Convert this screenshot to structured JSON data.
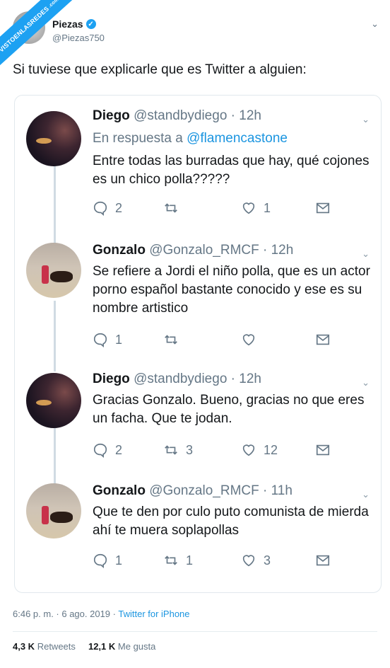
{
  "watermark": {
    "main": "VISTOENLASREDES",
    "suffix": ".com"
  },
  "header": {
    "author": "Piezas",
    "handle": "@Piezas750",
    "text": "Si tuviese que explicarle que es Twitter a alguien:"
  },
  "replies": [
    {
      "name": "Diego",
      "handle": "@standbydiego · 12h",
      "in_reply_prefix": "En respuesta a ",
      "in_reply_user": "@flamencastone",
      "text": "Entre todas las burradas que hay, qué cojones es un chico polla?????",
      "replies": "2",
      "retweets": "",
      "likes": "1"
    },
    {
      "name": "Gonzalo",
      "handle": "@Gonzalo_RMCF · 12h",
      "text": "Se refiere a Jordi el niño polla, que es un actor porno español bastante conocido y ese es su nombre artistico",
      "replies": "1",
      "retweets": "",
      "likes": ""
    },
    {
      "name": "Diego",
      "handle": "@standbydiego · 12h",
      "text": "Gracias Gonzalo. Bueno, gracias no que eres un facha. Que te jodan.",
      "replies": "2",
      "retweets": "3",
      "likes": "12"
    },
    {
      "name": "Gonzalo",
      "handle": "@Gonzalo_RMCF · 11h",
      "text": "Que te den por culo puto comunista de mierda ahí te muera soplapollas",
      "replies": "1",
      "retweets": "1",
      "likes": "3"
    }
  ],
  "meta": {
    "time": "6:46 p. m. · 6 ago. 2019 · ",
    "source": "Twitter for iPhone"
  },
  "stats": {
    "retweets_count": "4,3 K",
    "retweets_label": "Retweets",
    "likes_count": "12,1 K",
    "likes_label": "Me gusta"
  },
  "colors": {
    "accent": "#1da1f2",
    "link": "#1b95e0",
    "muted": "#657786"
  }
}
